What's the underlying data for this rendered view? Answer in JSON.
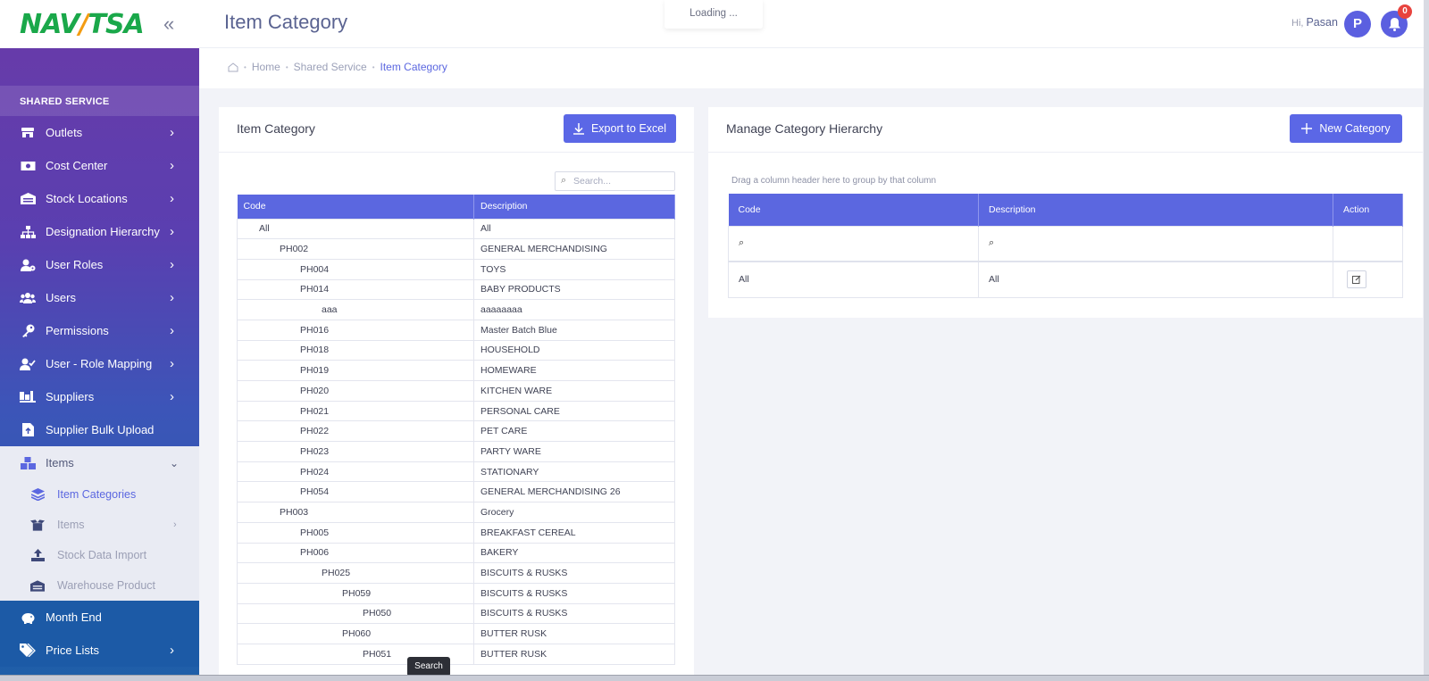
{
  "brand": {
    "logo_left": "NAV",
    "logo_slash": "/",
    "logo_right": "TSA",
    "collapse_icon": "double-chevron-left-icon"
  },
  "header": {
    "title": "Item Category",
    "loading": "Loading ...",
    "greeting": "Hi,",
    "user_name": "Pasan",
    "avatar_initial": "P",
    "notifications": "0"
  },
  "breadcrumb": {
    "home": "Home",
    "section": "Shared Service",
    "current": "Item Category"
  },
  "sidebar": {
    "section": "SHARED SERVICE",
    "items": [
      {
        "label": "Outlets",
        "icon": "store-icon"
      },
      {
        "label": "Cost Center",
        "icon": "money-icon"
      },
      {
        "label": "Stock Locations",
        "icon": "warehouse-icon"
      },
      {
        "label": "Designation Hierarchy",
        "icon": "sitemap-icon"
      },
      {
        "label": "User Roles",
        "icon": "user-cog-icon"
      },
      {
        "label": "Users",
        "icon": "users-icon"
      },
      {
        "label": "Permissions",
        "icon": "key-icon"
      },
      {
        "label": "User - Role Mapping",
        "icon": "user-check-icon"
      },
      {
        "label": "Suppliers",
        "icon": "truck-icon"
      },
      {
        "label": "Supplier Bulk Upload",
        "icon": "file-upload-icon"
      }
    ],
    "items_group": {
      "label": "Items",
      "icon": "boxes-icon"
    },
    "sub_items": [
      {
        "label": "Item Categories",
        "icon": "layers-icon"
      },
      {
        "label": "Items",
        "icon": "box-open-icon"
      },
      {
        "label": "Stock Data Import",
        "icon": "upload-icon"
      },
      {
        "label": "Warehouse Product",
        "icon": "warehouse-icon"
      }
    ],
    "after_items": [
      {
        "label": "Month End",
        "icon": "piggy-bank-icon"
      },
      {
        "label": "Price Lists",
        "icon": "tags-icon"
      }
    ]
  },
  "left_card": {
    "title": "Item Category",
    "export_label": "Export to Excel",
    "search_placeholder": "Search...",
    "columns": [
      "Code",
      "Description"
    ],
    "rows": [
      {
        "code": "All",
        "desc": "All",
        "level": 0
      },
      {
        "code": "PH002",
        "desc": "GENERAL MERCHANDISING",
        "level": 1
      },
      {
        "code": "PH004",
        "desc": "TOYS",
        "level": 2
      },
      {
        "code": "PH014",
        "desc": "BABY PRODUCTS",
        "level": 2
      },
      {
        "code": "aaa",
        "desc": "aaaaaaaa",
        "level": 3
      },
      {
        "code": "PH016",
        "desc": "Master Batch Blue",
        "level": 2
      },
      {
        "code": "PH018",
        "desc": "HOUSEHOLD",
        "level": 2
      },
      {
        "code": "PH019",
        "desc": "HOMEWARE",
        "level": 2
      },
      {
        "code": "PH020",
        "desc": "KITCHEN WARE",
        "level": 2
      },
      {
        "code": "PH021",
        "desc": "PERSONAL CARE",
        "level": 2
      },
      {
        "code": "PH022",
        "desc": "PET CARE",
        "level": 2
      },
      {
        "code": "PH023",
        "desc": "PARTY WARE",
        "level": 2
      },
      {
        "code": "PH024",
        "desc": "STATIONARY",
        "level": 2
      },
      {
        "code": "PH054",
        "desc": "GENERAL MERCHANDISING 26",
        "level": 2
      },
      {
        "code": "PH003",
        "desc": "Grocery",
        "level": 1
      },
      {
        "code": "PH005",
        "desc": "BREAKFAST CEREAL",
        "level": 2
      },
      {
        "code": "PH006",
        "desc": "BAKERY",
        "level": 2
      },
      {
        "code": "PH025",
        "desc": "BISCUITS & RUSKS",
        "level": 3
      },
      {
        "code": "PH059",
        "desc": "BISCUITS & RUSKS",
        "level": 4
      },
      {
        "code": "PH050",
        "desc": "BISCUITS & RUSKS",
        "level": 5
      },
      {
        "code": "PH060",
        "desc": "BUTTER RUSK",
        "level": 4
      },
      {
        "code": "PH051",
        "desc": "BUTTER RUSK",
        "level": 5
      }
    ]
  },
  "right_card": {
    "title": "Manage Category Hierarchy",
    "new_label": "New Category",
    "group_hint": "Drag a column header here to group by that column",
    "columns": [
      "Code",
      "Description",
      "Action"
    ],
    "rows": [
      {
        "code": "All",
        "desc": "All"
      }
    ]
  },
  "tooltip": "Search"
}
